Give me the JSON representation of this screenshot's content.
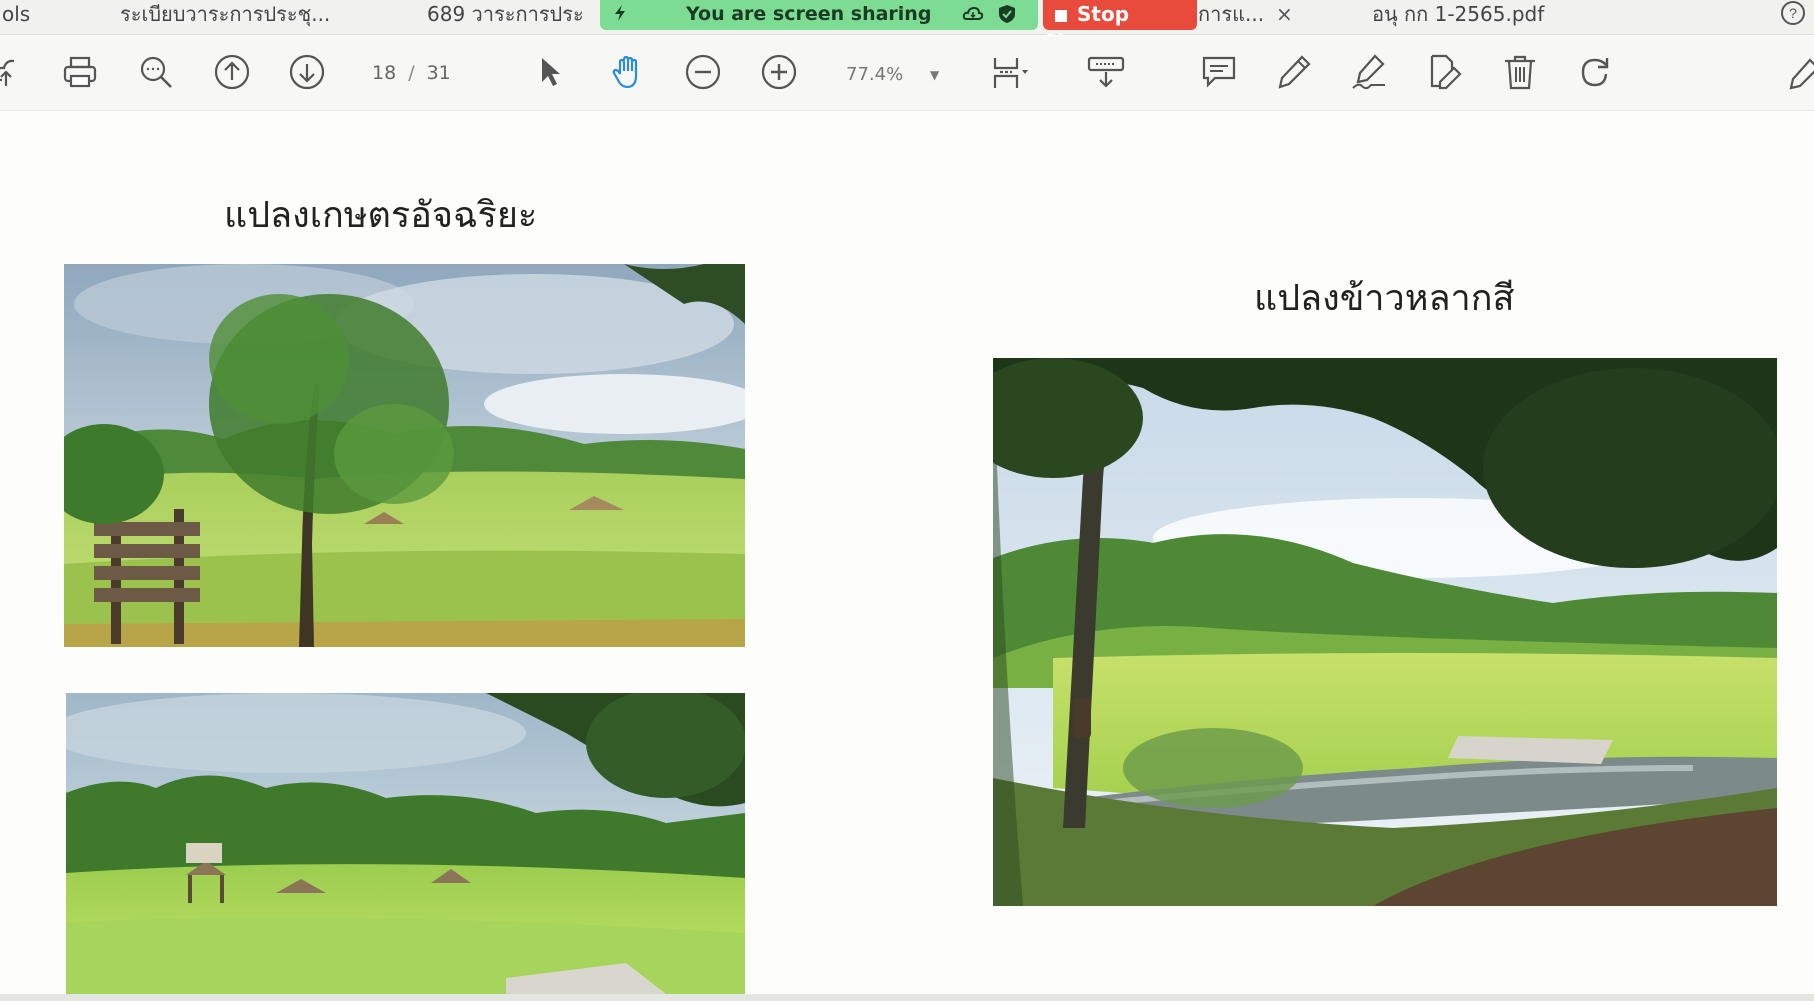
{
  "tabs": [
    {
      "label": "ols"
    },
    {
      "label": "ระเบียบวาระการประชุ..."
    },
    {
      "label": "689  วาระการประ"
    },
    {
      "label": "การแ..."
    },
    {
      "label": "อนุ กก 1-2565.pdf"
    }
  ],
  "tab_close": "×",
  "share_banner": {
    "text": "You are screen sharing",
    "stop_label": "Stop Share",
    "color": "#7ddc93",
    "stop_color": "#e84a3c"
  },
  "toolbar": {
    "current_page": "18",
    "page_separator": "/",
    "total_pages": "31",
    "zoom": "77.4%",
    "icons": [
      "upload-icon",
      "print-icon",
      "search-icon",
      "page-up-icon",
      "page-down-icon",
      "select-cursor-icon",
      "hand-tool-icon",
      "zoom-out-icon",
      "zoom-in-icon",
      "fit-page-icon",
      "download-icon",
      "comment-icon",
      "highlight-icon",
      "sign-icon",
      "edit-doc-icon",
      "delete-icon",
      "rotate-icon",
      "pen-icon"
    ]
  },
  "document": {
    "left_heading": "แปลงเกษตรอัจฉริยะ",
    "right_heading": "แปลงข้าวหลากสี"
  }
}
